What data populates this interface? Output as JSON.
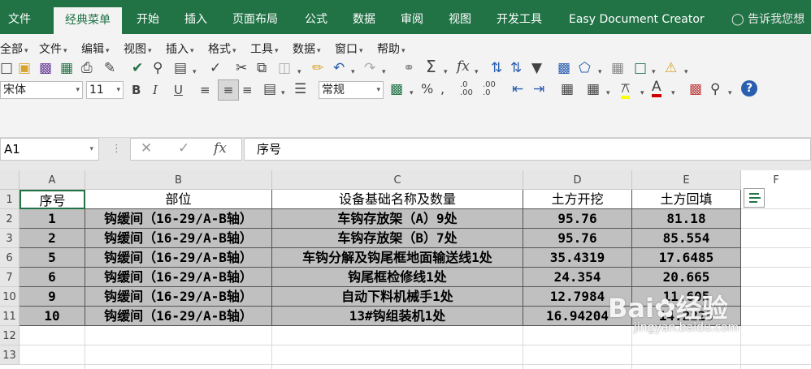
{
  "tabs": [
    "文件",
    "经典菜单",
    "开始",
    "插入",
    "页面布局",
    "公式",
    "数据",
    "审阅",
    "视图",
    "开发工具",
    "Easy Document Creator"
  ],
  "tell_me": "告诉我您想",
  "classic_menu": [
    "全部",
    "文件",
    "编辑",
    "视图",
    "插入",
    "格式",
    "工具",
    "数据",
    "窗口",
    "帮助"
  ],
  "font_name": "宋体",
  "font_size": "11",
  "number_format": "常规",
  "name_box": "A1",
  "formula_value": "序号",
  "columns": [
    "A",
    "B",
    "C",
    "D",
    "E",
    "F"
  ],
  "row_numbers": [
    "1",
    "2",
    "3",
    "6",
    "7",
    "10",
    "11",
    "12",
    "13"
  ],
  "table": {
    "headers": [
      "序号",
      "部位",
      "设备基础名称及数量",
      "土方开挖",
      "土方回填"
    ],
    "rows": [
      [
        "1",
        "钩缓间（16-29/A-B轴）",
        "车钩存放架（A）9处",
        "95.76",
        "81.18"
      ],
      [
        "2",
        "钩缓间（16-29/A-B轴）",
        "车钩存放架（B）7处",
        "95.76",
        "85.554"
      ],
      [
        "5",
        "钩缓间（16-29/A-B轴）",
        "车钩分解及钩尾框地面输送线1处",
        "35.4319",
        "17.6485"
      ],
      [
        "6",
        "钩缓间（16-29/A-B轴）",
        "钩尾框检修线1处",
        "24.354",
        "20.665"
      ],
      [
        "9",
        "钩缓间（16-29/A-B轴）",
        "自动下料机械手1处",
        "12.7984",
        "11.605"
      ],
      [
        "10",
        "钩缓间（16-29/A-B轴）",
        "13#钩组装机1处",
        "16.94204",
        "14.2225"
      ]
    ]
  },
  "watermark": {
    "brand": "Bai",
    "suffix": "经验",
    "url": "jingyan.baidu.com"
  },
  "colors": {
    "accent": "#217346",
    "selection_gray": "#c0c0c0"
  }
}
